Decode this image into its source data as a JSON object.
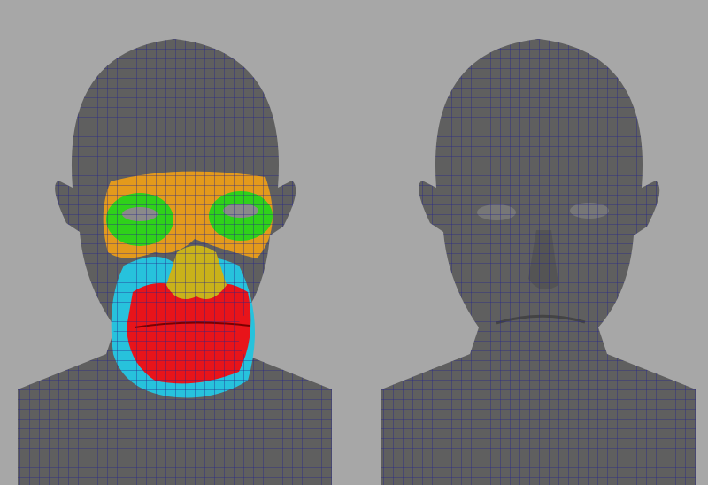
{
  "colors": {
    "background": "#a7a7a7",
    "mesh_surface": "#5f5f5f",
    "wireframe": "#25258a",
    "eye_ring": "#e39a1c",
    "eye_socket": "#2fd11a",
    "mouth_ring": "#27c2dc",
    "lips": "#e8141a",
    "nose": "#c9b21a"
  },
  "panels": [
    {
      "name": "head-with-colored-edge-loops"
    },
    {
      "name": "head-wireframe-only"
    }
  ]
}
